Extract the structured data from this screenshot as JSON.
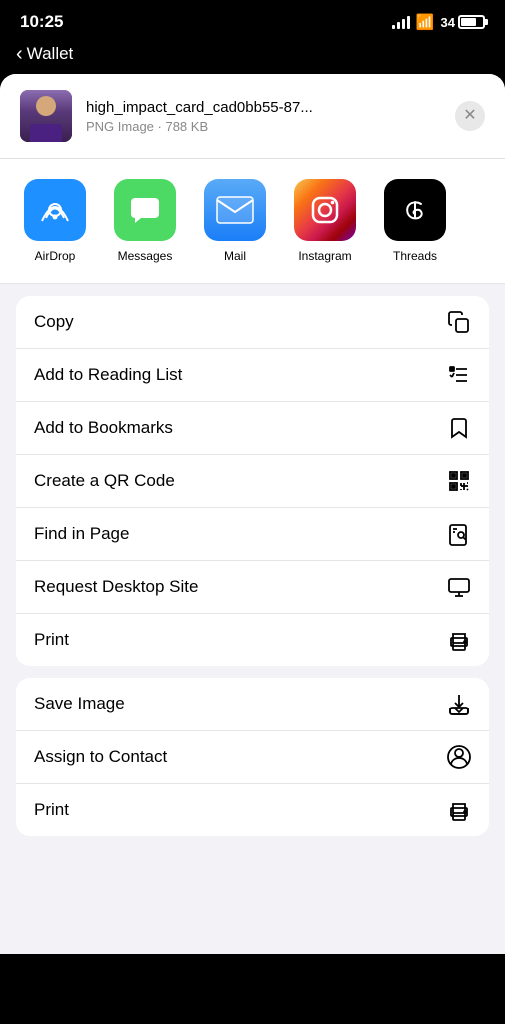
{
  "statusBar": {
    "time": "10:25",
    "batteryPercent": "34"
  },
  "navBar": {
    "backLabel": "Wallet"
  },
  "fileHeader": {
    "fileName": "high_impact_card_cad0bb55-87...",
    "fileMeta": "PNG Image · 788 KB",
    "closeLabel": "×"
  },
  "apps": [
    {
      "id": "airdrop",
      "label": "AirDrop"
    },
    {
      "id": "messages",
      "label": "Messages"
    },
    {
      "id": "mail",
      "label": "Mail"
    },
    {
      "id": "instagram",
      "label": "Instagram"
    },
    {
      "id": "threads",
      "label": "Threads"
    }
  ],
  "actionGroup1": [
    {
      "id": "copy",
      "label": "Copy",
      "icon": "copy"
    },
    {
      "id": "add-reading-list",
      "label": "Add to Reading List",
      "icon": "reading-list"
    },
    {
      "id": "add-bookmarks",
      "label": "Add to Bookmarks",
      "icon": "bookmark"
    },
    {
      "id": "qr-code",
      "label": "Create a QR Code",
      "icon": "qr"
    },
    {
      "id": "find-in-page",
      "label": "Find in Page",
      "icon": "find"
    },
    {
      "id": "request-desktop",
      "label": "Request Desktop Site",
      "icon": "desktop"
    },
    {
      "id": "print1",
      "label": "Print",
      "icon": "print"
    }
  ],
  "actionGroup2": [
    {
      "id": "save-image",
      "label": "Save Image",
      "icon": "save"
    },
    {
      "id": "assign-contact",
      "label": "Assign to Contact",
      "icon": "contact"
    },
    {
      "id": "print2",
      "label": "Print",
      "icon": "print"
    }
  ]
}
